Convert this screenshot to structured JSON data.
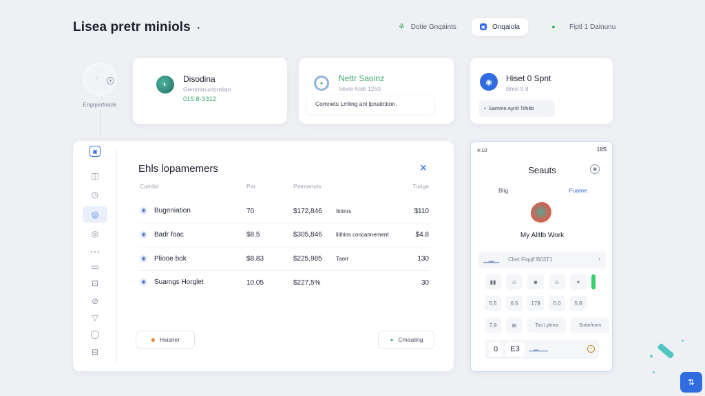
{
  "header": {
    "title": "Lisea pretr miniols",
    "title_suffix": "·",
    "nav_1": "Dotie Gnqaints",
    "nav_2": "Onqaiola",
    "nav_3": "Fiptl 1 Dainunu"
  },
  "profile": {
    "label": "Engrpertiviole"
  },
  "stats": [
    {
      "title": "Disodina",
      "subtitle": "Geramtnuctcrnilqn",
      "value": "015.8-3312"
    },
    {
      "title": "Nettr Saoinz",
      "subtitle": "Vexie Aoib 1250",
      "note": "Comnets Lmling anl lpnaitniton."
    },
    {
      "title": "Hiset 0 Spnt",
      "subtitle": "Bnisl 9 8",
      "chip": "Samme Aynlt Tilhitb"
    }
  ],
  "table": {
    "title": "Ehls lopamemers",
    "columns": [
      "Cumfal",
      "Par",
      "Patmenuts",
      "",
      "Turige"
    ],
    "rows": [
      {
        "name": "Bugeniation",
        "c1": "70",
        "c2": "$172,846",
        "c3": "Itntnrs",
        "c4": "$110"
      },
      {
        "name": "Badr foac",
        "c1": "$8.5",
        "c2": "$305,846",
        "c3": "lilihins concannement",
        "c4": "$4.8"
      },
      {
        "name": "Pliooe bok",
        "c1": "$8.83",
        "c2": "$225,985",
        "c3": "Taorr",
        "c4": "130"
      },
      {
        "name": "Suamgs Horglet",
        "c1": "10.05",
        "c2": "$227,5%",
        "c3": "",
        "c4": "30"
      }
    ],
    "button_left": "Hiasner",
    "button_right": "Cmaaling"
  },
  "phone": {
    "time_left": "4:10",
    "time_right": "18S",
    "title": "Seauts",
    "tab_left": "Blig",
    "tab_right": "Fuame",
    "user_name": "My Alltlb Work",
    "banner_text": "Clert Fiqqif B03T1",
    "grid_labels": [
      "5.5",
      "6.5",
      "178",
      "0.0",
      "5.8"
    ],
    "row2_labels": [
      "7.8",
      "Tas Lylena",
      "Sotarfnom"
    ],
    "bottom_left": "0",
    "bottom_mid": "E3"
  }
}
